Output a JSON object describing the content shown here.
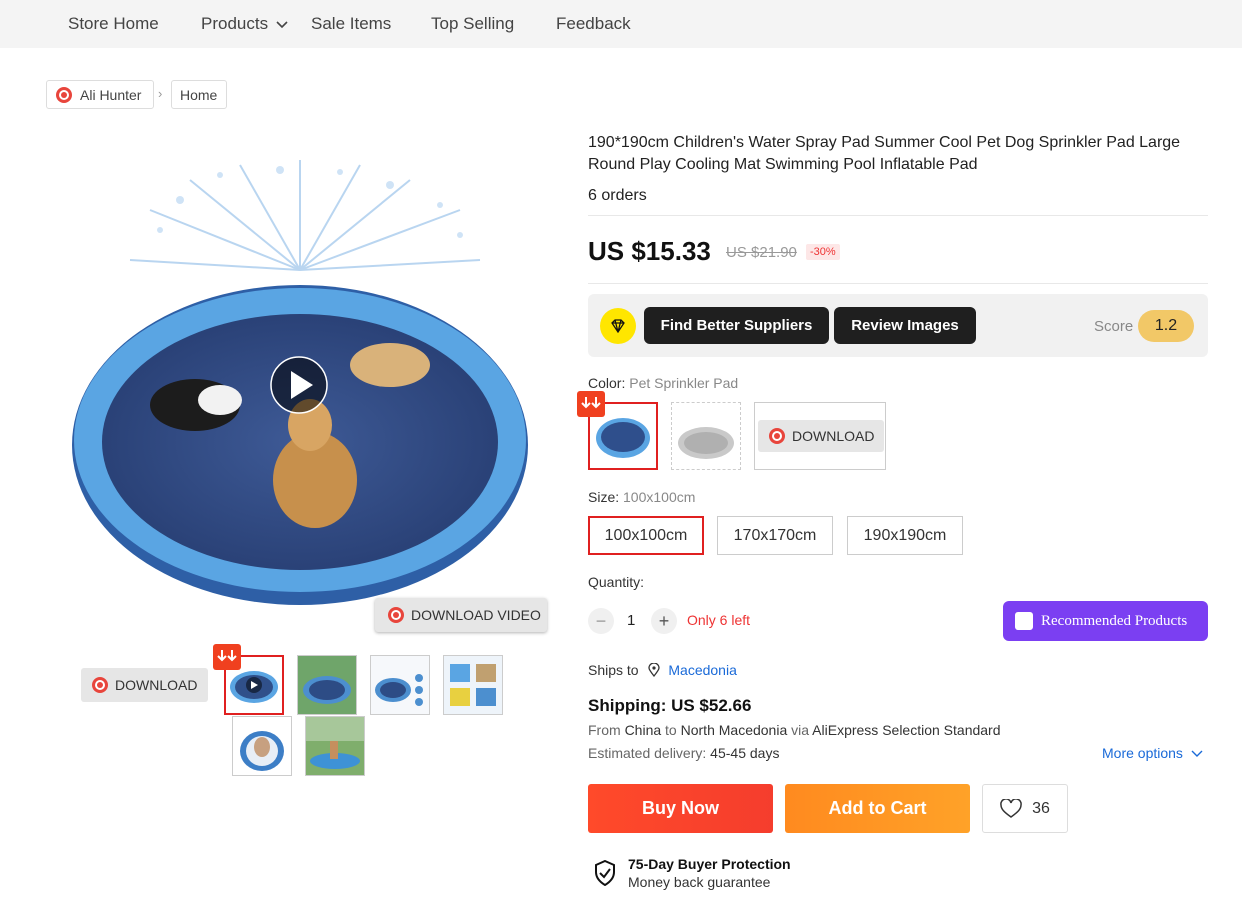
{
  "nav": {
    "items": [
      "Store Home",
      "Products",
      "Sale Items",
      "Top Selling",
      "Feedback"
    ]
  },
  "breadcrumb": {
    "store": "Ali Hunter",
    "home": "Home",
    "separator": "›"
  },
  "gallery": {
    "download_video_label": "DOWNLOAD VIDEO",
    "download_label": "DOWNLOAD",
    "thumbnail_count": 6,
    "selected_thumbnail": 1
  },
  "product": {
    "title": "190*190cm Children's Water Spray Pad Summer Cool Pet Dog Sprinkler Pad Large Round Play Cooling Mat Swimming Pool Inflatable Pad",
    "orders": "6 orders",
    "price": "US $15.33",
    "old_price": "US $21.90",
    "discount": "-30%"
  },
  "toolbar": {
    "find_suppliers": "Find Better Suppliers",
    "review_images": "Review Images",
    "score_label": "Score",
    "score_value": "1.2"
  },
  "color": {
    "label": "Color:",
    "selected": "Pet Sprinkler Pad",
    "download_label": "DOWNLOAD"
  },
  "size": {
    "label": "Size:",
    "selected": "100x100cm",
    "options": [
      "100x100cm",
      "170x170cm",
      "190x190cm"
    ]
  },
  "quantity": {
    "label": "Quantity:",
    "minus": "−",
    "plus": "+",
    "value": "1",
    "stock_note": "Only 6 left"
  },
  "recommended": {
    "label": "Recommended Products"
  },
  "shipping": {
    "ships_to_label": "Ships to",
    "country": "Macedonia",
    "cost": "Shipping: US $52.66",
    "from_prefix": "From",
    "from_country": "China",
    "to_prefix": "to",
    "to_country": "North Macedonia",
    "via_prefix": "via",
    "carrier": "AliExpress Selection Standard",
    "estimated_label": "Estimated delivery:",
    "estimated_value": "45-45 days",
    "more_options": "More options"
  },
  "actions": {
    "buy_now": "Buy Now",
    "add_to_cart": "Add to Cart",
    "wishlist_count": "36"
  },
  "protection": {
    "title": "75-Day Buyer Protection",
    "subtitle": "Money back guarantee"
  },
  "colors": {
    "accent_red": "#e02020",
    "buy_now": "#f53d2d",
    "add_to_cart": "#ff9a24",
    "score_badge": "#f2c867",
    "recommended": "#7b3ff2",
    "link": "#1a6ad8"
  }
}
